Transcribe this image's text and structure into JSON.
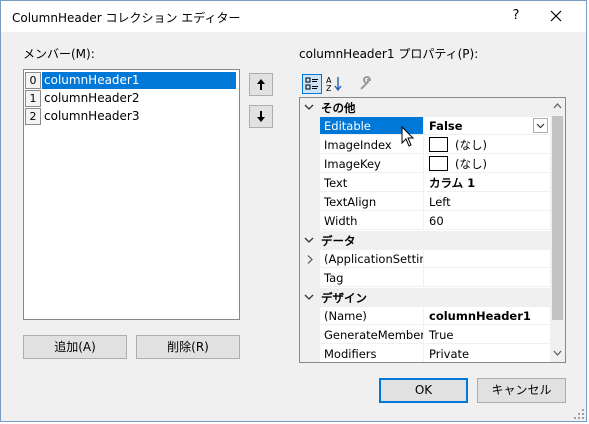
{
  "dialog": {
    "title": "ColumnHeader コレクション エディター",
    "help_label": "?"
  },
  "members": {
    "label": "メンバー(M):",
    "items": [
      {
        "index": "0",
        "name": "columnHeader1",
        "selected": true
      },
      {
        "index": "1",
        "name": "columnHeader2",
        "selected": false
      },
      {
        "index": "2",
        "name": "columnHeader3",
        "selected": false
      }
    ],
    "add_label": "追加(A)",
    "remove_label": "削除(R)"
  },
  "properties": {
    "label": "columnHeader1 プロパティ(P):",
    "toolbar_icons": [
      "categorized-view-icon",
      "alphabetical-sort-icon",
      "property-pages-icon"
    ],
    "categories": [
      {
        "name": "その他",
        "rows": [
          {
            "name": "Editable",
            "value": "False",
            "bold": true,
            "selected": true
          },
          {
            "name": "ImageIndex",
            "value": "(なし)",
            "swatch": true
          },
          {
            "name": "ImageKey",
            "value": "(なし)",
            "swatch": true
          },
          {
            "name": "Text",
            "value": "カラム 1",
            "bold": true
          },
          {
            "name": "TextAlign",
            "value": "Left"
          },
          {
            "name": "Width",
            "value": "60"
          }
        ]
      },
      {
        "name": "データ",
        "rows": [
          {
            "name": "(ApplicationSettings)",
            "value": "",
            "expandable": true
          },
          {
            "name": "Tag",
            "value": ""
          }
        ]
      },
      {
        "name": "デザイン",
        "rows": [
          {
            "name": "(Name)",
            "value": "columnHeader1",
            "bold": true
          },
          {
            "name": "GenerateMember",
            "value": "True"
          },
          {
            "name": "Modifiers",
            "value": "Private"
          }
        ]
      }
    ]
  },
  "footer": {
    "ok_label": "OK",
    "cancel_label": "キャンセル"
  },
  "colors": {
    "selection": "#0078d7",
    "window_bg": "#f0f0f0"
  }
}
